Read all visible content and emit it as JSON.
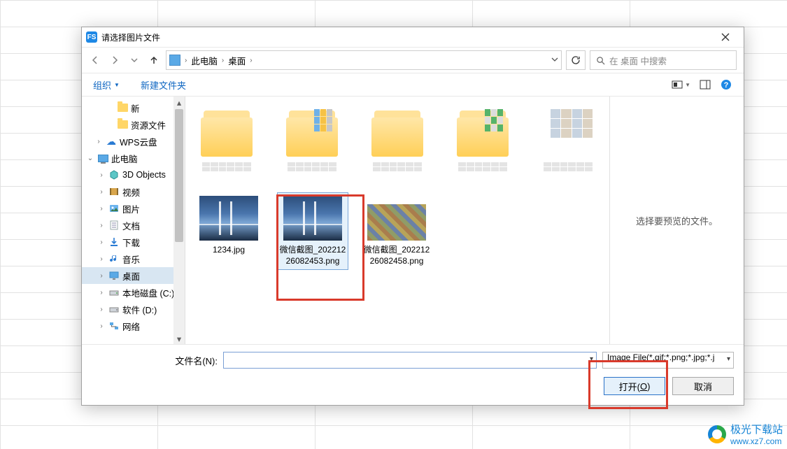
{
  "dialog": {
    "title": "请选择图片文件",
    "app_icon_text": "FS"
  },
  "nav": {
    "crumb_root": "此电脑",
    "crumb_leaf": "桌面",
    "search_placeholder": "在 桌面 中搜索"
  },
  "toolbar": {
    "organize": "组织",
    "new_folder": "新建文件夹"
  },
  "tree": {
    "items": [
      {
        "indent": 34,
        "exp": "",
        "icon": "folder",
        "label": "新"
      },
      {
        "indent": 34,
        "exp": "",
        "icon": "folder",
        "label": "资源文件"
      },
      {
        "indent": 18,
        "exp": ">",
        "icon": "cloud",
        "label": "WPS云盘"
      },
      {
        "indent": 6,
        "exp": "v",
        "icon": "pc",
        "label": "此电脑"
      },
      {
        "indent": 22,
        "exp": ">",
        "icon": "3d",
        "label": "3D Objects"
      },
      {
        "indent": 22,
        "exp": ">",
        "icon": "vid",
        "label": "视频"
      },
      {
        "indent": 22,
        "exp": ">",
        "icon": "img",
        "label": "图片"
      },
      {
        "indent": 22,
        "exp": ">",
        "icon": "doc",
        "label": "文档"
      },
      {
        "indent": 22,
        "exp": ">",
        "icon": "dl",
        "label": "下载"
      },
      {
        "indent": 22,
        "exp": ">",
        "icon": "mus",
        "label": "音乐"
      },
      {
        "indent": 22,
        "exp": ">",
        "icon": "desk",
        "label": "桌面",
        "selected": true
      },
      {
        "indent": 22,
        "exp": ">",
        "icon": "drv",
        "label": "本地磁盘 (C:)"
      },
      {
        "indent": 22,
        "exp": ">",
        "icon": "drv2",
        "label": "软件 (D:)"
      },
      {
        "indent": 22,
        "exp": ">",
        "icon": "net",
        "label": "网络"
      }
    ]
  },
  "files": {
    "items": [
      {
        "name": "1234.jpg",
        "thumb": "bridge"
      },
      {
        "name": "微信截图_20221226082453.png",
        "thumb": "bridge",
        "selected": true
      },
      {
        "name": "微信截图_20221226082458.png",
        "thumb": "mosaic"
      }
    ]
  },
  "preview": {
    "empty_text": "选择要预览的文件。"
  },
  "footer": {
    "filename_label": "文件名(N):",
    "filename_value": "",
    "type_filter": "Image File(*.gif;*.png;*.jpg;*.j",
    "open_btn": "打开(O)",
    "cancel_btn": "取消"
  },
  "watermark": {
    "brand": "极光下载站",
    "url": "www.xz7.com"
  }
}
